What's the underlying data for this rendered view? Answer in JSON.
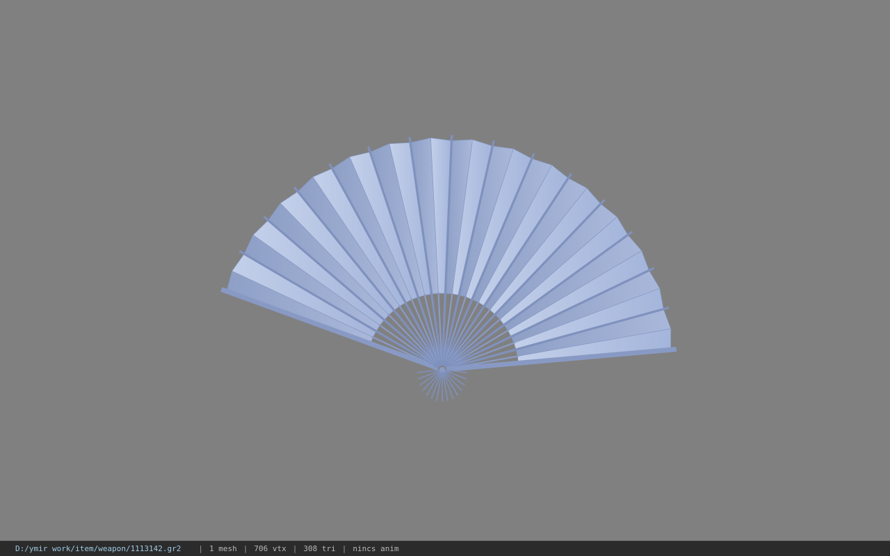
{
  "viewport": {
    "background": "#808080",
    "model": {
      "name": "folding-fan",
      "color": "#9aaacf",
      "rib_count": 15
    }
  },
  "status_bar": {
    "file_path": "D:/ymir work/item/weapon/1113142.gr2",
    "separator": "|",
    "mesh_count": "1 mesh",
    "vertex_count": "706 vtx",
    "triangle_count": "308 tri",
    "animation": "nincs anim"
  }
}
